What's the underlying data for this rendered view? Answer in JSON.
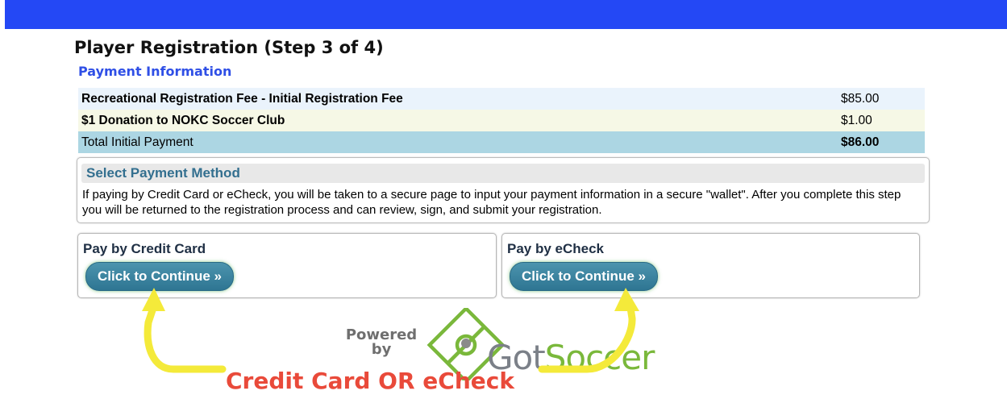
{
  "page": {
    "title": "Player Registration (Step 3 of 4)",
    "section_title": "Payment Information"
  },
  "fees": {
    "rows": [
      {
        "label": "Recreational Registration Fee - Initial Registration Fee",
        "amount": "$85.00"
      },
      {
        "label": "$1 Donation to NOKC Soccer Club",
        "amount": "$1.00"
      }
    ],
    "total": {
      "label": "Total Initial Payment",
      "amount": "$86.00"
    }
  },
  "payment_method": {
    "title": "Select Payment Method",
    "description": "If paying by Credit Card or eCheck, you will be taken to a secure page to input your payment information in a secure \"wallet\". After you complete this step you will be returned to the registration process and can review, sign, and submit your registration."
  },
  "credit_card": {
    "title": "Pay by Credit Card",
    "button_label": "Click to Continue »"
  },
  "echeck": {
    "title": "Pay by eCheck",
    "button_label": "Click to Continue »"
  },
  "logo": {
    "powered_line1": "Powered",
    "powered_line2": "by",
    "brand_part1": "Got",
    "brand_part2": "Soccer"
  },
  "annotation": {
    "text": "Credit Card OR eCheck"
  },
  "colors": {
    "top_bar": "#2448f5",
    "section_title": "#2f4fe6",
    "button": "#2e7592",
    "annotation_text": "#e94a3a",
    "annotation_arrow": "#f4ea3a",
    "brand_green": "#7ab83b"
  }
}
